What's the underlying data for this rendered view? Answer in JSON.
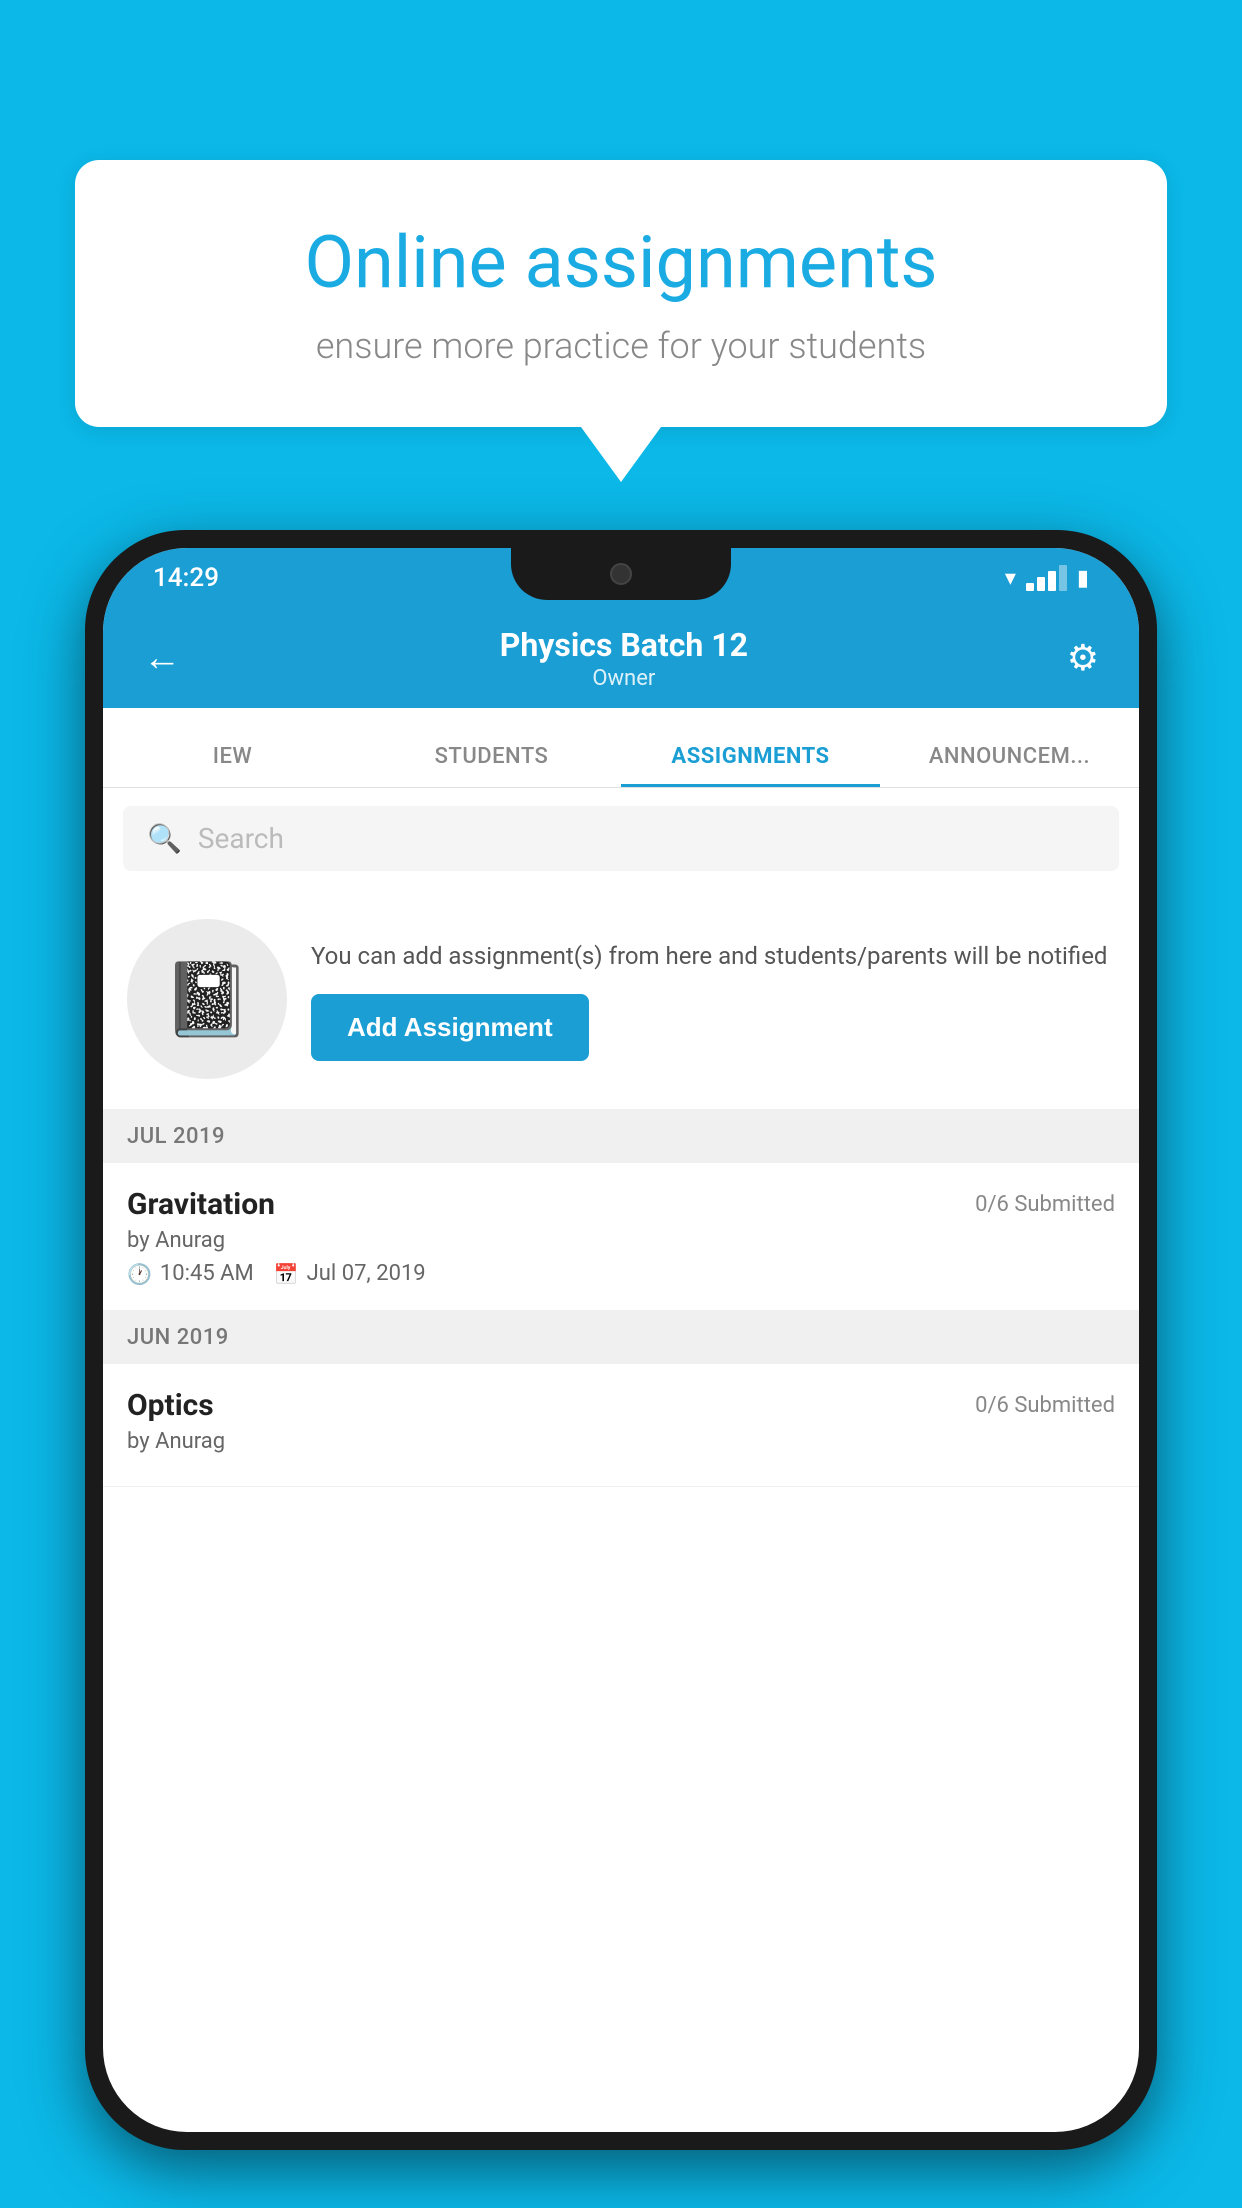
{
  "background_color": "#0BB8E8",
  "speech_bubble": {
    "title": "Online assignments",
    "subtitle": "ensure more practice for your students"
  },
  "phone": {
    "status_bar": {
      "time": "14:29"
    },
    "app_bar": {
      "title": "Physics Batch 12",
      "subtitle": "Owner",
      "back_label": "←",
      "settings_label": "⚙"
    },
    "tabs": [
      {
        "label": "IEW",
        "active": false
      },
      {
        "label": "STUDENTS",
        "active": false
      },
      {
        "label": "ASSIGNMENTS",
        "active": true
      },
      {
        "label": "ANNOUNCEM...",
        "active": false
      }
    ],
    "search": {
      "placeholder": "Search"
    },
    "promo": {
      "text": "You can add assignment(s) from here and students/parents will be notified",
      "button_label": "Add Assignment"
    },
    "sections": [
      {
        "month": "JUL 2019",
        "assignments": [
          {
            "name": "Gravitation",
            "submitted": "0/6 Submitted",
            "by": "by Anurag",
            "time": "10:45 AM",
            "date": "Jul 07, 2019"
          }
        ]
      },
      {
        "month": "JUN 2019",
        "assignments": [
          {
            "name": "Optics",
            "submitted": "0/6 Submitted",
            "by": "by Anurag",
            "time": "",
            "date": ""
          }
        ]
      }
    ]
  }
}
